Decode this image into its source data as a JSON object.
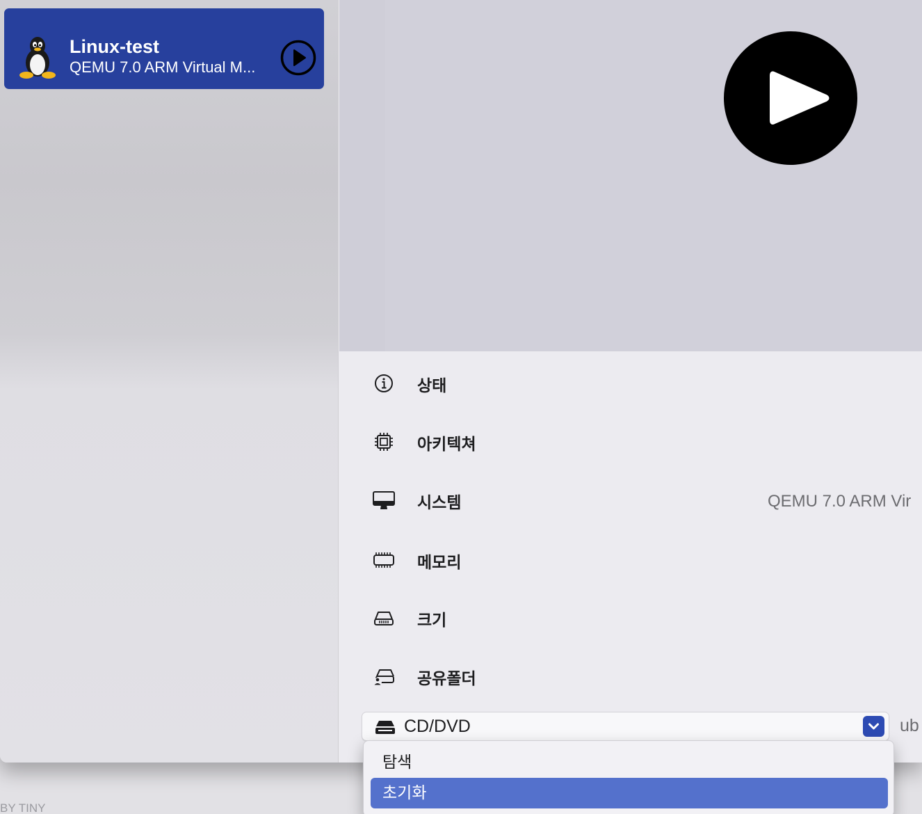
{
  "sidebar": {
    "vm": {
      "name": "Linux-test",
      "subtitle": "QEMU 7.0 ARM Virtual M...",
      "logo_icon": "tux-penguin-icon",
      "play_icon": "play-circle-icon",
      "card_color": "#27409d"
    }
  },
  "preview": {
    "play_icon": "play-large-icon"
  },
  "details": {
    "rows": [
      {
        "label": "상태",
        "icon": "info-circle-icon",
        "value": ""
      },
      {
        "label": "아키텍쳐",
        "icon": "cpu-chip-icon",
        "value": ""
      },
      {
        "label": "시스템",
        "icon": "desktop-display-icon",
        "value": "QEMU 7.0 ARM Vir"
      },
      {
        "label": "메모리",
        "icon": "memory-module-icon",
        "value": ""
      },
      {
        "label": "크기",
        "icon": "hard-drive-icon",
        "value": ""
      },
      {
        "label": "공유폴더",
        "icon": "shared-drive-person-icon",
        "value": ""
      }
    ],
    "drive": {
      "selected": "CD/DVD",
      "icon": "optical-drive-icon",
      "value": "ub"
    }
  },
  "menu": {
    "items": [
      {
        "label": "탐색",
        "selected": false
      },
      {
        "label": "초기화",
        "selected": true
      }
    ],
    "highlight_color": "#5471cc"
  },
  "watermark": "BY TINY"
}
